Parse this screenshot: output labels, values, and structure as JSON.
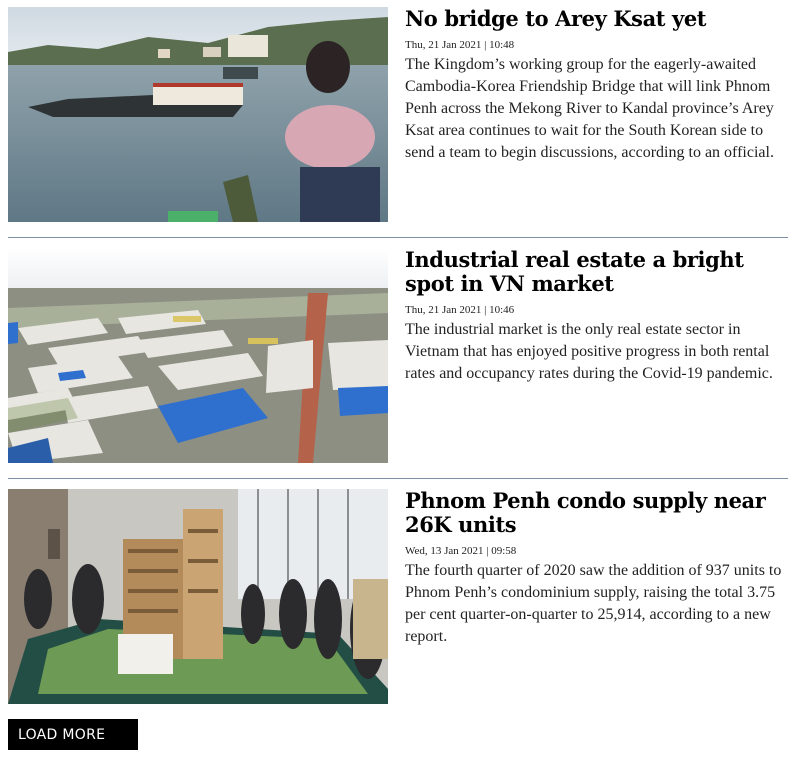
{
  "articles": [
    {
      "headline": "No bridge to Arey Ksat yet",
      "timestamp": "Thu, 21 Jan 2021 | 10:48",
      "summary": "The Kingdom’s working group for the eagerly-awaited Cambodia-Korea Friendship Bridge that will link Phnom Penh across the Mekong River to Kandal province’s Arey Ksat area continues to wait for the South Korean side to send a team to begin discussions, according to an official."
    },
    {
      "headline": "Industrial real estate a bright spot in VN market",
      "timestamp": "Thu, 21 Jan 2021 | 10:46",
      "summary": "The industrial market is the only real estate sector in Vietnam that has enjoyed positive progress in both rental rates and occupancy rates during the Covid-19 pandemic."
    },
    {
      "headline": "Phnom Penh condo supply near 26K units",
      "timestamp": "Wed, 13 Jan 2021 | 09:58",
      "summary": "The fourth quarter of 2020 saw the addition of 937 units to Phnom Penh’s condominium supply, raising the total 3.75 per cent quarter-on-quarter to 25,914, according to a new report."
    }
  ],
  "load_more_label": "LOAD MORE"
}
